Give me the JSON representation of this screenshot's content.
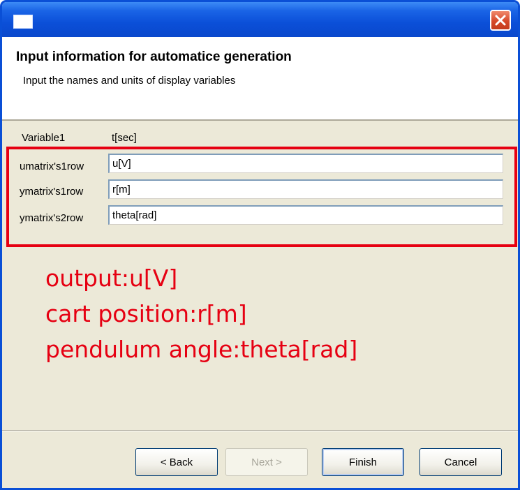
{
  "window": {
    "title": ""
  },
  "header": {
    "title": "Input information for automatice generation",
    "description": "Input the names and units of display variables"
  },
  "variables": {
    "variable1": {
      "label": "Variable1",
      "value": "t[sec]"
    },
    "rows": [
      {
        "label": "umatrix's1row",
        "value": "u[V]"
      },
      {
        "label": "ymatrix's1row",
        "value": "r[m]"
      },
      {
        "label": "ymatrix's2row",
        "value": "theta[rad]"
      }
    ]
  },
  "annotation": {
    "lines": [
      "output:u[V]",
      "cart position:r[m]",
      "pendulum angle:theta[rad]"
    ],
    "color": "#e60012"
  },
  "buttons": {
    "back": "< Back",
    "next": "Next >",
    "finish": "Finish",
    "cancel": "Cancel"
  },
  "icons": {
    "close": "close-icon",
    "app": "window-icon"
  }
}
